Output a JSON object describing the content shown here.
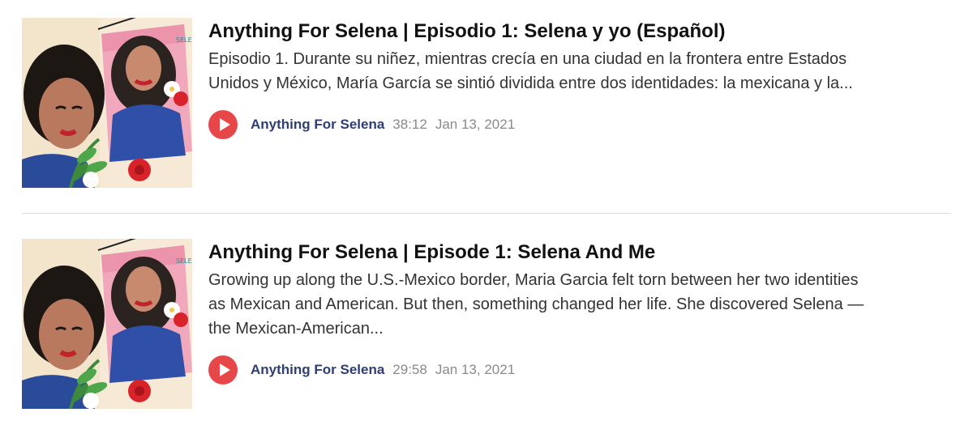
{
  "episodes": [
    {
      "title": "Anything For Selena | Episodio 1: Selena y yo (Español)",
      "description_line1": "Episodio 1. Durante su niñez, mientras crecía en una ciudad en la frontera entre Estados",
      "description_line2": "Unidos y México, María García se sintió dividida entre dos identidades: la mexicana y la...",
      "description_line3": "",
      "podcast": "Anything For Selena",
      "duration": "38:12",
      "date": "Jan 13, 2021",
      "art_text": "SELENA"
    },
    {
      "title": "Anything For Selena | Episode 1: Selena And Me",
      "description_line1": "Growing up along the U.S.-Mexico border, Maria Garcia felt torn between her two identities",
      "description_line2": "as Mexican and American. But then, something changed her life. She discovered Selena —",
      "description_line3": "the Mexican-American...",
      "podcast": "Anything For Selena",
      "duration": "29:58",
      "date": "Jan 13, 2021",
      "art_text": "SELENA"
    }
  ],
  "colors": {
    "play": "#e8474a",
    "podcast_link": "#2f3e74",
    "meta_gray": "#8a8a8a"
  },
  "icons": {
    "play": "play-icon"
  }
}
